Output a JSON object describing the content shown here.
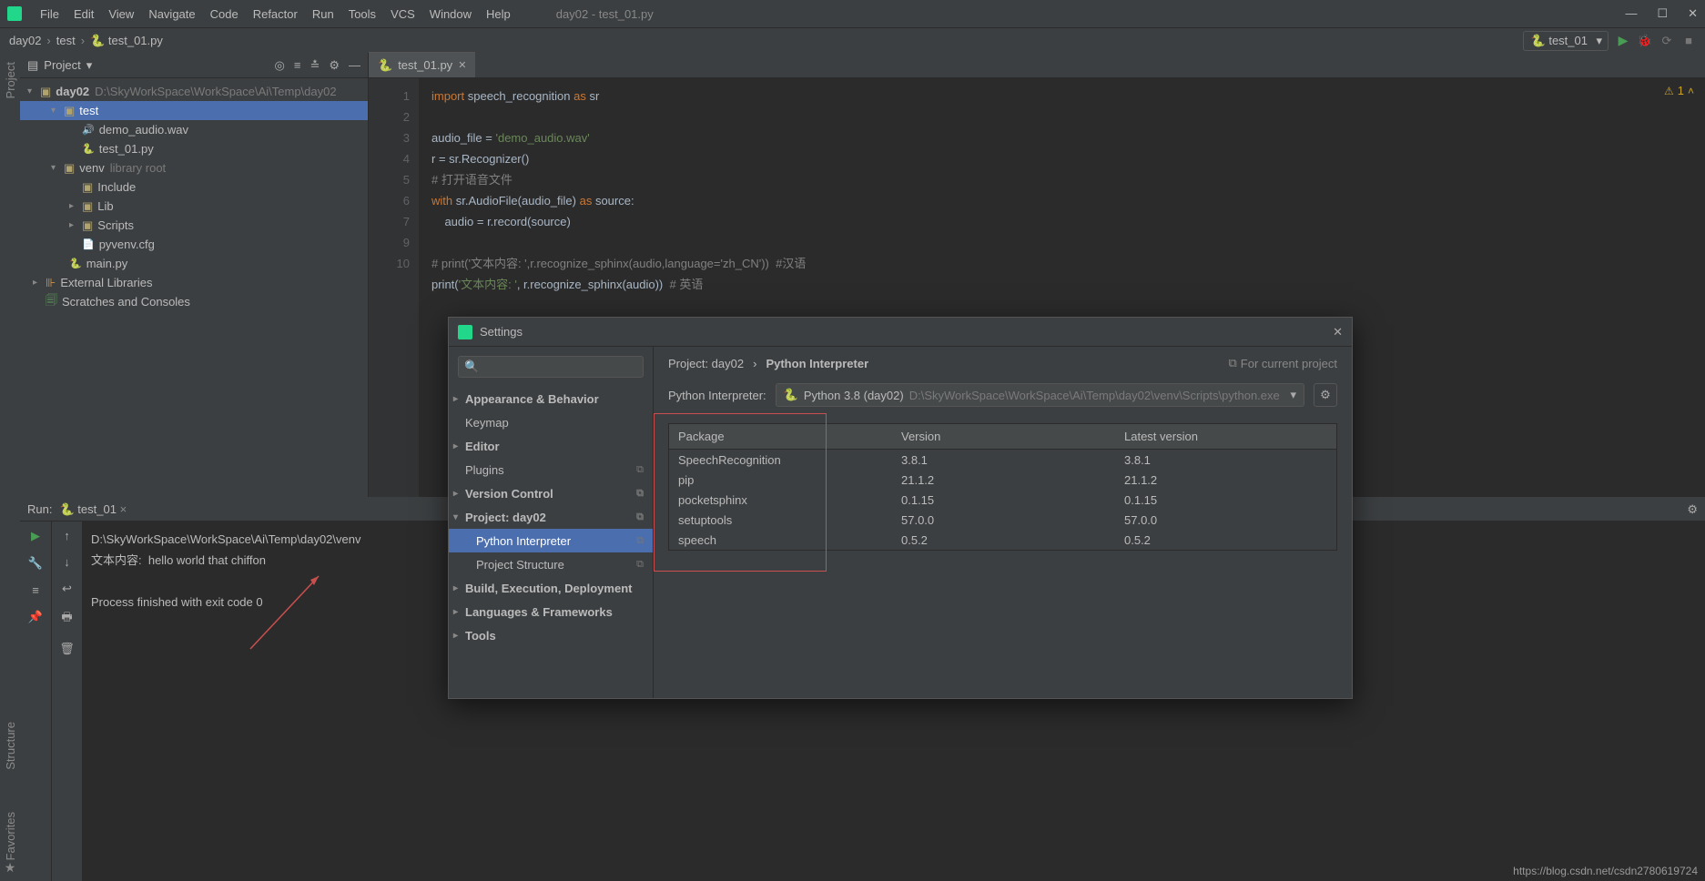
{
  "menubar": {
    "items": [
      "File",
      "Edit",
      "View",
      "Navigate",
      "Code",
      "Refactor",
      "Run",
      "Tools",
      "VCS",
      "Window",
      "Help"
    ],
    "window_title": "day02 - test_01.py"
  },
  "breadcrumbs": {
    "parts": [
      "day02",
      "test",
      "test_01.py"
    ]
  },
  "run_config": {
    "selected": "test_01"
  },
  "project_tree": {
    "title": "Project",
    "root": {
      "name": "day02",
      "path": "D:\\SkyWorkSpace\\WorkSpace\\Ai\\Temp\\day02"
    },
    "test_folder": "test",
    "files": {
      "demo_audio": "demo_audio.wav",
      "test01": "test_01.py"
    },
    "venv": {
      "name": "venv",
      "note": "library root",
      "include": "Include",
      "lib": "Lib",
      "scripts": "Scripts",
      "pyvenv": "pyvenv.cfg"
    },
    "main": "main.py",
    "ext_lib": "External Libraries",
    "scratches": "Scratches and Consoles"
  },
  "editor": {
    "tab": "test_01.py",
    "gutter": [
      "1",
      "2",
      "3",
      "4",
      "5",
      "6",
      "7",
      "",
      "9",
      "10"
    ],
    "warn_count": "1",
    "lines": {
      "l1a": "import",
      "l1b": " speech_recognition ",
      "l1c": "as",
      "l1d": " sr",
      "l3a": "audio_file = ",
      "l3b": "'demo_audio.wav'",
      "l4": "r = sr.Recognizer()",
      "l5": "# 打开语音文件",
      "l6a": "with",
      "l6b": " sr.AudioFile(audio_file) ",
      "l6c": "as",
      "l6d": " source:",
      "l7": "    audio = r.record(source)",
      "l9a": "# print('文本内容: ',r.recognize_sphinx(audio,language='zh_CN'))  ",
      "l9b": "#汉语",
      "l10a": "print(",
      "l10b": "'文本内容: '",
      "l10c": ", r.recognize_sphinx(audio))  ",
      "l10d": "# 英语"
    }
  },
  "run_panel": {
    "title": "Run:",
    "config": "test_01",
    "out1": "D:\\SkyWorkSpace\\WorkSpace\\Ai\\Temp\\day02\\venv",
    "out2": "文本内容:  hello world that chiffon",
    "out3": "Process finished with exit code 0"
  },
  "settings": {
    "title": "Settings",
    "search_placeholder": "",
    "nav": {
      "appearance": "Appearance & Behavior",
      "keymap": "Keymap",
      "editor": "Editor",
      "plugins": "Plugins",
      "vcs": "Version Control",
      "project": "Project: day02",
      "py_interp": "Python Interpreter",
      "proj_struct": "Project Structure",
      "build": "Build, Execution, Deployment",
      "lang": "Languages & Frameworks",
      "tools": "Tools"
    },
    "crumb": {
      "project": "Project: day02",
      "sep": "›",
      "interp": "Python Interpreter",
      "forcur": "For current project"
    },
    "interp_label": "Python Interpreter:",
    "interp_value": "Python 3.8 (day02)",
    "interp_path": "D:\\SkyWorkSpace\\WorkSpace\\Ai\\Temp\\day02\\venv\\Scripts\\python.exe",
    "table": {
      "headers": {
        "pkg": "Package",
        "ver": "Version",
        "latest": "Latest version"
      },
      "rows": [
        {
          "pkg": "SpeechRecognition",
          "ver": "3.8.1",
          "latest": "3.8.1"
        },
        {
          "pkg": "pip",
          "ver": "21.1.2",
          "latest": "21.1.2"
        },
        {
          "pkg": "pocketsphinx",
          "ver": "0.1.15",
          "latest": "0.1.15"
        },
        {
          "pkg": "setuptools",
          "ver": "57.0.0",
          "latest": "57.0.0"
        },
        {
          "pkg": "speech",
          "ver": "0.5.2",
          "latest": "0.5.2"
        }
      ]
    }
  },
  "watermark": "https://blog.csdn.net/csdn2780619724"
}
